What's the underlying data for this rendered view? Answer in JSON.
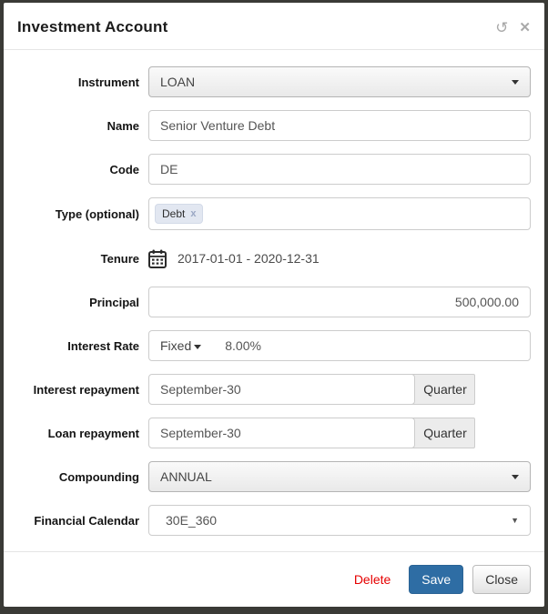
{
  "modal": {
    "title": "Investment Account",
    "undo_icon": "↺",
    "close_icon": "✕"
  },
  "form": {
    "instrument": {
      "label": "Instrument",
      "value": "LOAN"
    },
    "name": {
      "label": "Name",
      "value": "Senior Venture Debt"
    },
    "code": {
      "label": "Code",
      "value": "DE"
    },
    "type": {
      "label": "Type (optional)",
      "tag": "Debt",
      "tag_remove": "x"
    },
    "tenure": {
      "label": "Tenure",
      "value": "2017-01-01 - 2020-12-31"
    },
    "principal": {
      "label": "Principal",
      "value": "500,000.00"
    },
    "interest_rate": {
      "label": "Interest Rate",
      "mode": "Fixed",
      "value": "8.00%"
    },
    "interest_repayment": {
      "label": "Interest repayment",
      "value": "September-30",
      "addon": "Quarter"
    },
    "loan_repayment": {
      "label": "Loan repayment",
      "value": "September-30",
      "addon": "Quarter"
    },
    "compounding": {
      "label": "Compounding",
      "value": "ANNUAL"
    },
    "financial_calendar": {
      "label": "Financial Calendar",
      "value": "30E_360",
      "caret": "▼"
    }
  },
  "footer": {
    "delete_label": "Delete",
    "save_label": "Save",
    "close_label": "Close"
  },
  "colors": {
    "save_bg": "#2e6da4",
    "delete_text": "#e60000",
    "frame": "#3a3a36"
  }
}
